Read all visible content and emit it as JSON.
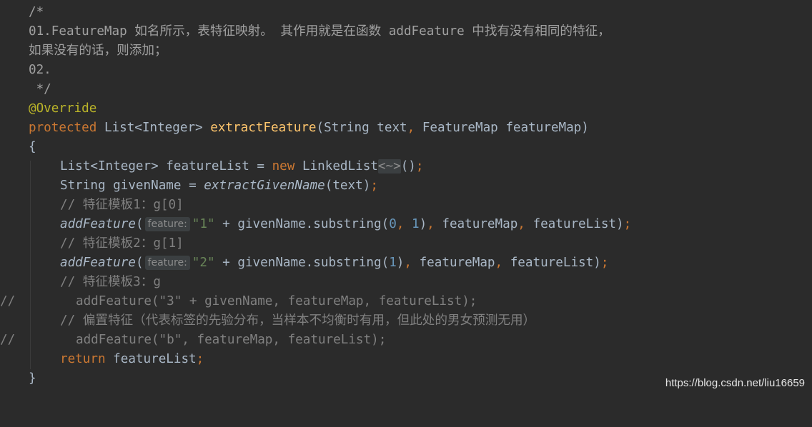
{
  "editor": {
    "lines": {
      "l1": "/*",
      "l2": "01.FeatureMap 如名所示，表特征映射。 其作用就是在函数 addFeature 中找有没有相同的特征，",
      "l3": "如果没有的话，则添加；",
      "l4": "02.",
      "l5": " */",
      "l6": "@Override",
      "l7": {
        "kw": "protected",
        "type": "List<Integer>",
        "method": "extractFeature",
        "params_open": "(String text",
        "comma": ",",
        "params_rest": " FeatureMap featureMap)"
      },
      "l8": "{",
      "l9": {
        "a": "List<Integer> featureList = ",
        "kw": "new",
        "b": " LinkedList",
        "diamond": "<~>",
        "c": "()",
        "semi": ";"
      },
      "l10": {
        "a": "String givenName = ",
        "call": "extractGivenName",
        "b": "(text)",
        "semi": ";"
      },
      "l11": "// 特征模板1：g[0]",
      "l12": {
        "call": "addFeature",
        "open": "(",
        "hint": "feature:",
        "str": "\"1\"",
        "a": " + givenName.substring(",
        "n1": "0",
        "comma1": ",",
        "n2": " 1",
        "b": ")",
        "comma2": ",",
        "c": " featureMap",
        "comma3": ",",
        "d": " featureList)",
        "semi": ";"
      },
      "l13": "// 特征模板2：g[1]",
      "l14": {
        "call": "addFeature",
        "open": "(",
        "hint": "feature:",
        "str": "\"2\"",
        "a": " + givenName.substring(",
        "n1": "1",
        "b": ")",
        "comma2": ",",
        "c": " featureMap",
        "comma3": ",",
        "d": " featureList)",
        "semi": ";"
      },
      "l15": "// 特征模板3：g",
      "l16": {
        "gutter": "//",
        "text": "addFeature(\"3\" + givenName, featureMap, featureList);"
      },
      "l17": "// 偏置特征（代表标签的先验分布，当样本不均衡时有用，但此处的男女预测无用）",
      "l18": {
        "gutter": "//",
        "text": "addFeature(\"b\", featureMap, featureList);"
      },
      "l19": {
        "kw": "return",
        "a": " featureList",
        "semi": ";"
      },
      "l20": "}"
    }
  },
  "watermark": "https://blog.csdn.net/liu16659"
}
